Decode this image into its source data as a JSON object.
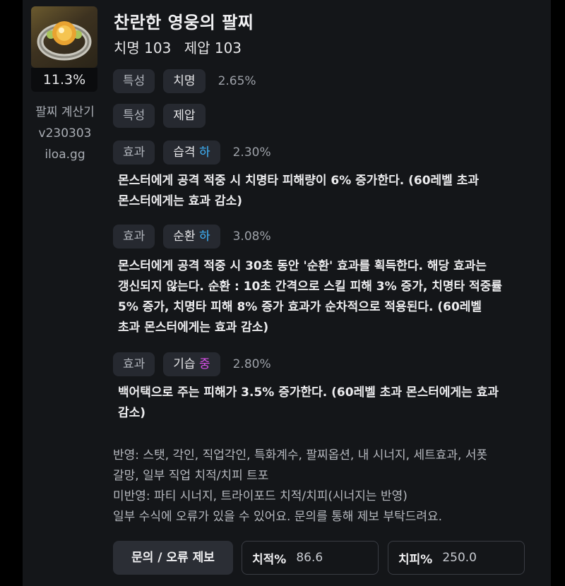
{
  "item": {
    "icon": "bracelet-icon",
    "percent": "11.3%",
    "name": "찬란한 영웅의 팔찌",
    "stats": [
      "치명 103",
      "제압 103"
    ]
  },
  "sidebar": {
    "calc_name": "팔찌 계산기",
    "version": "v230303",
    "site": "iloa.gg"
  },
  "rows": [
    {
      "type": "특성",
      "name": "치명",
      "grade": "",
      "value": "2.65%"
    },
    {
      "type": "특성",
      "name": "제압",
      "grade": "",
      "value": ""
    },
    {
      "type": "효과",
      "name": "습격",
      "grade": "하",
      "value": "2.30%",
      "desc": [
        "몬스터에게 공격 적중 시 치명타 피해량이 6% 증가한다. (60레벨 초과",
        "몬스터에게는 효과 감소)"
      ]
    },
    {
      "type": "효과",
      "name": "순환",
      "grade": "하",
      "value": "3.08%",
      "desc": [
        "몬스터에게 공격 적중 시 30초 동안 '순환' 효과를 획득한다. 해당 효과는",
        "갱신되지 않는다. 순환 : 10초 간격으로 스킬 피해 3% 증가, 치명타 적중률",
        "5% 증가, 치명타 피해 8% 증가 효과가 순차적으로 적용된다. (60레벨",
        "초과 몬스터에게는 효과 감소)"
      ]
    },
    {
      "type": "효과",
      "name": "기습",
      "grade": "중",
      "value": "2.80%",
      "desc": [
        "백어택으로 주는 피해가 3.5% 증가한다. (60레벨 초과 몬스터에게는 효과",
        "감소)"
      ]
    }
  ],
  "notes": [
    "반영: 스탯, 각인, 직업각인, 특화계수, 팔찌옵션, 내 시너지, 세트효과, 서폿",
    "갈망, 일부 직업 치적/치피 트포",
    "미반영: 파티 시너지, 트라이포드 치적/치피(시너지는 반영)",
    "일부 수식에 오류가 있을 수 있어요. 문의를 통해 제보 부탁드려요."
  ],
  "footer": {
    "report_button": "문의 / 오류 제보",
    "crit_rate_label": "치적%",
    "crit_rate_value": "86.6",
    "crit_dmg_label": "치피%",
    "crit_dmg_value": "250.0"
  },
  "colors": {
    "grade_low": "#3fb6ff",
    "grade_mid": "#d84fe8"
  }
}
